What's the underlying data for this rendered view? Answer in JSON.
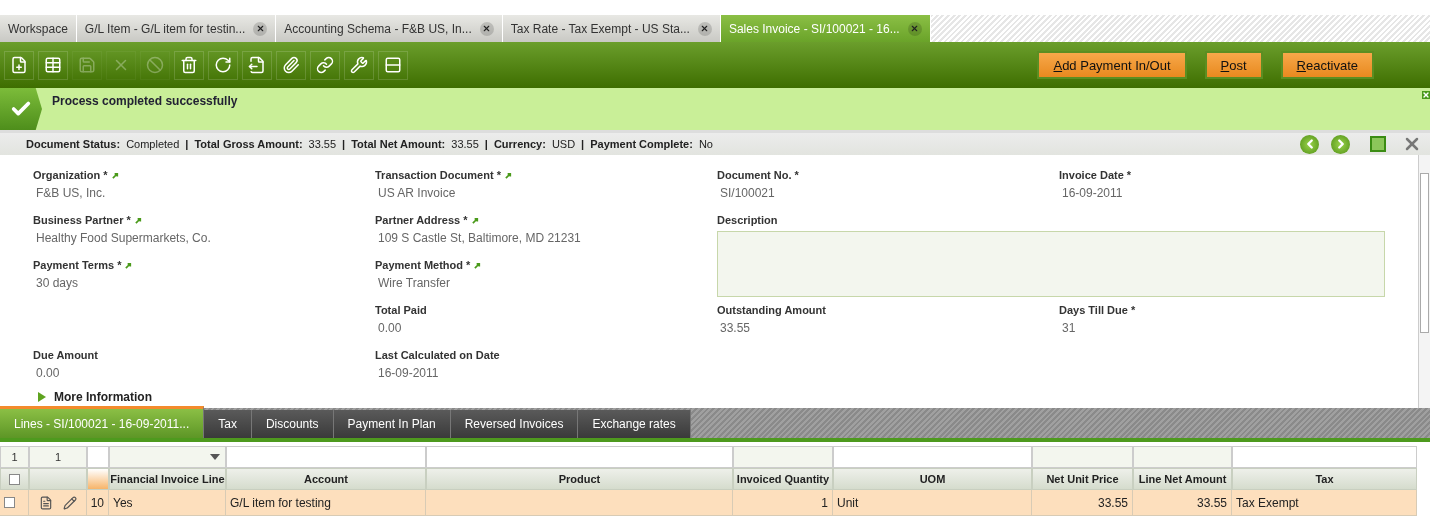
{
  "tabs": [
    {
      "label": "Workspace",
      "closable": false,
      "selected": false
    },
    {
      "label": "G/L Item - G/L item for testin...",
      "closable": true,
      "selected": false
    },
    {
      "label": "Accounting Schema - F&B US, In...",
      "closable": true,
      "selected": false
    },
    {
      "label": "Tax Rate - Tax Exempt - US Sta...",
      "closable": true,
      "selected": false
    },
    {
      "label": "Sales Invoice - SI/100021 - 16...",
      "closable": true,
      "selected": true
    }
  ],
  "toolbar": [
    {
      "disabled": false
    },
    {
      "disabled": false
    },
    {
      "disabled": true
    },
    {
      "disabled": true
    },
    {
      "disabled": true
    },
    {
      "disabled": false
    },
    {
      "disabled": false
    },
    {
      "disabled": false
    },
    {
      "disabled": false
    },
    {
      "disabled": false
    },
    {
      "disabled": false
    },
    {
      "disabled": false
    }
  ],
  "actions": [
    "Add Payment In/Out",
    "Post",
    "Reactivate"
  ],
  "message": {
    "text": "Process completed successfully"
  },
  "status_bar": {
    "separator": "|",
    "items": [
      {
        "label": "Document Status:",
        "value": "Completed"
      },
      {
        "label": "Total Gross Amount:",
        "value": "33.55"
      },
      {
        "label": "Total Net Amount:",
        "value": "33.55"
      },
      {
        "label": "Currency:",
        "value": "USD"
      },
      {
        "label": "Payment Complete:",
        "value": "No"
      }
    ]
  },
  "fields": [
    {
      "kind": "text",
      "label": "Organization *",
      "link": true,
      "value": "F&B US, Inc."
    },
    {
      "kind": "text",
      "label": "Transaction Document *",
      "link": true,
      "value": "US AR Invoice"
    },
    {
      "kind": "text",
      "label": "Document No. *",
      "link": false,
      "value": "SI/100021"
    },
    {
      "kind": "text",
      "label": "Invoice Date *",
      "link": false,
      "value": "16-09-2011"
    },
    {
      "kind": "text",
      "label": "Business Partner *",
      "link": true,
      "value": "Healthy Food Supermarkets, Co."
    },
    {
      "kind": "text",
      "label": "Partner Address *",
      "link": true,
      "value": "109 S Castle St, Baltimore, MD 21231"
    },
    {
      "kind": "textarea",
      "label": "Description",
      "link": false
    },
    {
      "kind": "text",
      "label": "Payment Terms *",
      "link": true,
      "value": "30 days"
    },
    {
      "kind": "text",
      "label": "Payment Method *",
      "link": true,
      "value": "Wire Transfer"
    },
    {
      "kind": "text",
      "label": "Total Paid",
      "link": false,
      "value": "0.00"
    },
    {
      "kind": "text",
      "label": "Outstanding Amount",
      "link": false,
      "value": "33.55"
    },
    {
      "kind": "text",
      "label": "Days Till Due *",
      "link": false,
      "value": "31"
    },
    {
      "kind": "text",
      "label": "Due Amount",
      "link": false,
      "value": "0.00"
    },
    {
      "kind": "text",
      "label": "Last Calculated on Date",
      "link": false,
      "value": "16-09-2011"
    }
  ],
  "more_information": {
    "label": "More Information",
    "expanded": false
  },
  "subtabs": [
    {
      "label": "Lines - SI/100021 - 16-09-2011...",
      "selected": true
    },
    {
      "label": "Tax",
      "selected": false
    },
    {
      "label": "Discounts",
      "selected": false
    },
    {
      "label": "Payment In Plan",
      "selected": false
    },
    {
      "label": "Reversed Invoices",
      "selected": false
    },
    {
      "label": "Exchange rates",
      "selected": false
    }
  ],
  "grid": {
    "counts": [
      "1",
      "1"
    ],
    "select_all_checked": false,
    "columns": [
      {
        "label": "Financial Invoice Line",
        "kind": "select"
      },
      {
        "label": "Account",
        "kind": "input"
      },
      {
        "label": "Product",
        "kind": "input"
      },
      {
        "label": "Invoiced Quantity",
        "kind": "none"
      },
      {
        "label": "UOM",
        "kind": "input"
      },
      {
        "label": "Net Unit Price",
        "kind": "none"
      },
      {
        "label": "Line Net Amount",
        "kind": "none"
      },
      {
        "label": "Tax",
        "kind": "input"
      }
    ],
    "rows": [
      {
        "selected": true,
        "checked": false,
        "line_no": "10",
        "cells": [
          "Yes",
          "G/L item for testing",
          "",
          "1",
          "Unit",
          "33.55",
          "33.55",
          "Tax Exempt"
        ]
      }
    ]
  }
}
